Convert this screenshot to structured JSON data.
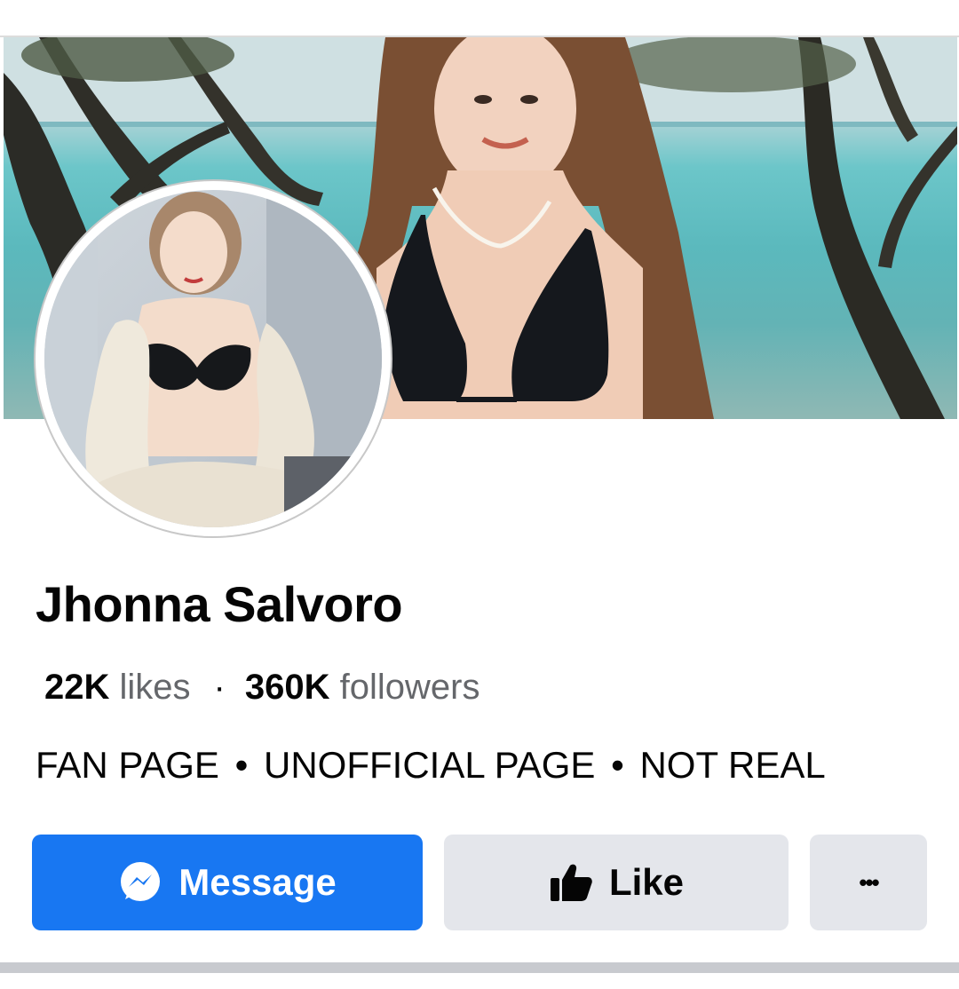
{
  "profile": {
    "name": "Jhonna Salvoro",
    "likes_count": "22K",
    "likes_label": "likes",
    "followers_count": "360K",
    "followers_label": "followers",
    "stats_separator": "·",
    "category": [
      "FAN PAGE",
      "UNOFFICIAL PAGE",
      "NOT REAL"
    ],
    "category_separator": "•"
  },
  "actions": {
    "message_label": "Message",
    "like_label": "Like",
    "more_label": "•••"
  },
  "icons": {
    "message": "messenger-icon",
    "like": "thumbs-up-icon",
    "more": "more-options-icon"
  },
  "colors": {
    "primary": "#1877f2",
    "secondary_button": "#e4e6eb",
    "text": "#050505",
    "muted_text": "#65676b"
  }
}
